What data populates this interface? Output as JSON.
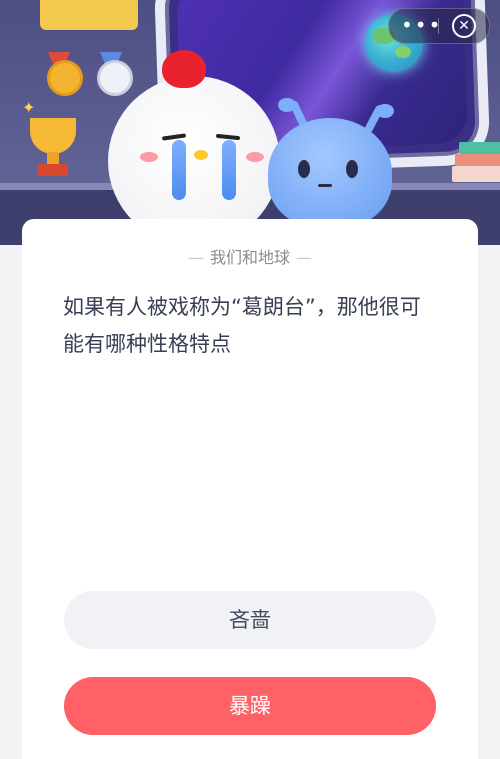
{
  "header": {
    "menu_icon": "more-dots-icon",
    "close_icon": "close-circle-icon"
  },
  "quiz": {
    "category": "我们和地球",
    "question": "如果有人被戏称为“葛朗台”，那他很可能有哪种性格特点",
    "options": [
      {
        "label": "吝啬"
      },
      {
        "label": "暴躁"
      }
    ]
  },
  "colors": {
    "header_bg": "#4d4e82",
    "option_primary": "#ff6166",
    "option_secondary": "#f1f2f6",
    "question_text": "#3a3f55"
  }
}
